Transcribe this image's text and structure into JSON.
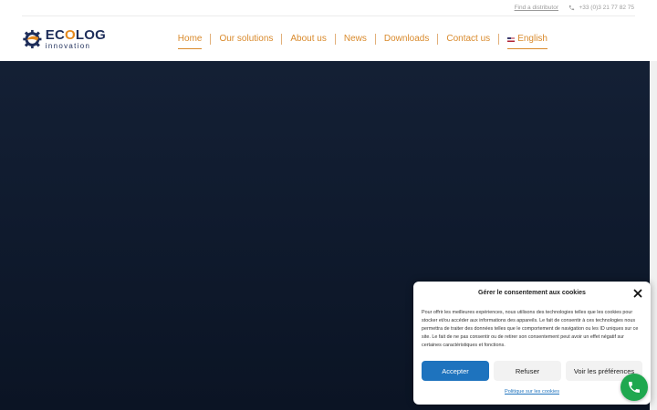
{
  "topbar": {
    "find_distributor": "Find a distributor",
    "phone": "+33 (0)3 21 77 82 75",
    "phone_icon": "phone-icon"
  },
  "logo": {
    "name_prefix": "EC",
    "name_o": "O",
    "name_suffix": "LOG",
    "tagline": "innovation",
    "colors": {
      "primary": "#1e2e5a",
      "accent": "#e58a1f"
    }
  },
  "nav": {
    "items": [
      {
        "label": "Home",
        "active": true
      },
      {
        "label": "Our solutions"
      },
      {
        "label": "About us"
      },
      {
        "label": "News"
      },
      {
        "label": "Downloads"
      },
      {
        "label": "Contact us"
      }
    ],
    "language": {
      "label": "English",
      "flag_icon": "us-flag-icon"
    },
    "color": "#d98a2c"
  },
  "hero": {
    "background": "#111c30"
  },
  "consent": {
    "title": "Gérer le consentement aux cookies",
    "text": "Pour offrir les meilleures expériences, nous utilisons des technologies telles que les cookies pour stocker et/ou accéder aux informations des appareils. Le fait de consentir à ces technologies nous permettra de traiter des données telles que le comportement de navigation ou les ID uniques sur ce site. Le fait de ne pas consentir ou de retirer son consentement peut avoir un effet négatif sur certaines caractéristiques et fonctions.",
    "accept": "Accepter",
    "refuse": "Refuser",
    "preferences": "Voir les préférences",
    "policy_link": "Politique sur les cookies",
    "accent_color": "#1e73be"
  },
  "call_button": {
    "icon": "phone-icon",
    "color": "#1fa84f"
  }
}
